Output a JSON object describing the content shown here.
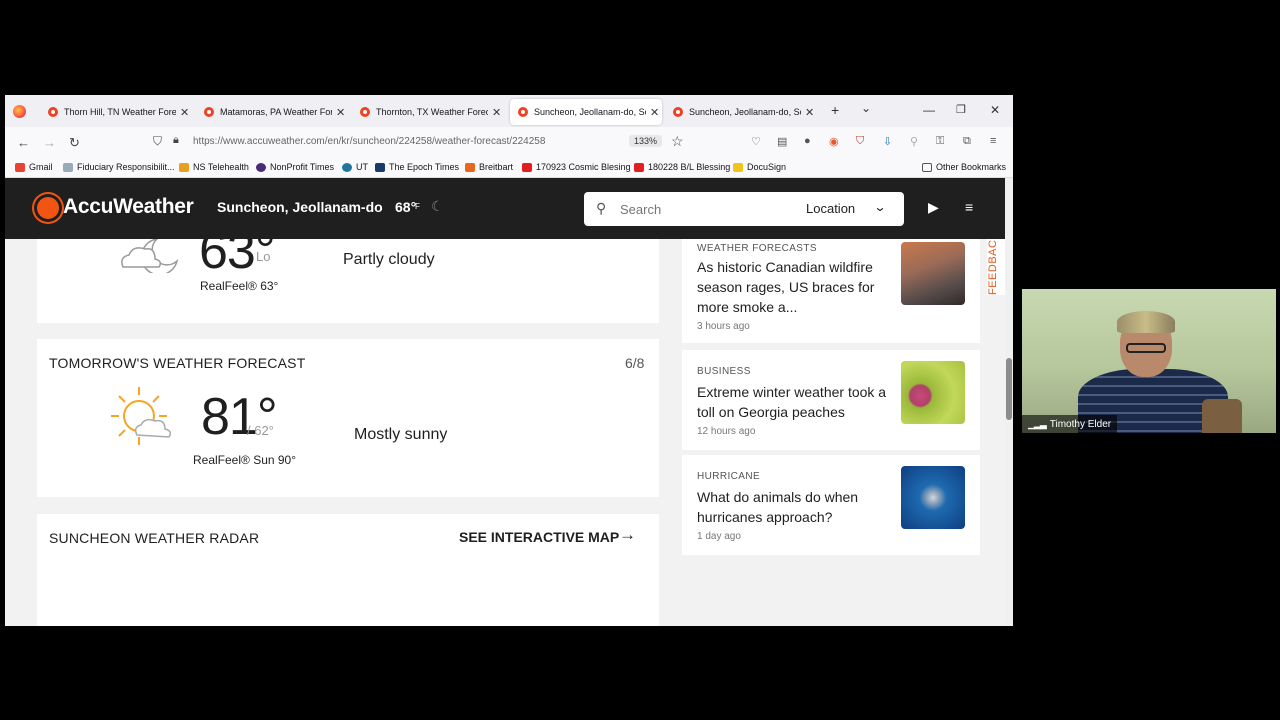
{
  "browser": {
    "tabs": [
      {
        "label": "Thorn Hill, TN Weather Forec",
        "active": false
      },
      {
        "label": "Matamoras, PA Weather Fore",
        "active": false
      },
      {
        "label": "Thornton, TX Weather Foreca",
        "active": false
      },
      {
        "label": "Suncheon, Jeollanam-do, So",
        "active": true
      },
      {
        "label": "Suncheon, Jeollanam-do, So",
        "active": false
      }
    ],
    "url": "https://www.accuweather.com/en/kr/suncheon/224258/weather-forecast/224258",
    "zoom": "133%",
    "bookmarks": [
      "Gmail",
      "Fiduciary Responsibilit...",
      "NS Telehealth",
      "NonProfit Times",
      "UT",
      "The Epoch Times",
      "Breitbart",
      "170923 Cosmic Blesing",
      "180228 B/L Blessing",
      "DocuSign"
    ],
    "other_bookmarks": "Other Bookmarks"
  },
  "header": {
    "brand": "AccuWeather",
    "location": "Suncheon, Jeollanam-do",
    "temp": "68°",
    "temp_unit": "F",
    "search_placeholder": "Search",
    "location_button": "Location"
  },
  "tonight": {
    "temp": "63°",
    "lo_label": "Lo",
    "realfeel": "RealFeel® 63°",
    "phrase": "Partly cloudy"
  },
  "tomorrow": {
    "title": "TOMORROW'S WEATHER FORECAST",
    "date": "6/8",
    "temp": "81°",
    "lo": "/ 62°",
    "realfeel": "RealFeel® Sun 90°",
    "phrase": "Mostly sunny"
  },
  "radar": {
    "title": "SUNCHEON WEATHER RADAR",
    "link": "SEE INTERACTIVE MAP"
  },
  "news": [
    {
      "category": "WEATHER FORECASTS",
      "title": "As historic Canadian wildfire season rages, US braces for more smoke a...",
      "time": "3 hours ago"
    },
    {
      "category": "BUSINESS",
      "title": "Extreme winter weather took a toll on Georgia peaches",
      "time": "12 hours ago"
    },
    {
      "category": "HURRICANE",
      "title": "What do animals do when hurricanes approach?",
      "time": "1 day ago"
    }
  ],
  "feedback": "FEEDBACK",
  "webcam": {
    "name": "Timothy Elder"
  },
  "colors": {
    "accent": "#f05514",
    "header_bg": "#1f1f1f",
    "page_bg": "#f2f2f2"
  }
}
